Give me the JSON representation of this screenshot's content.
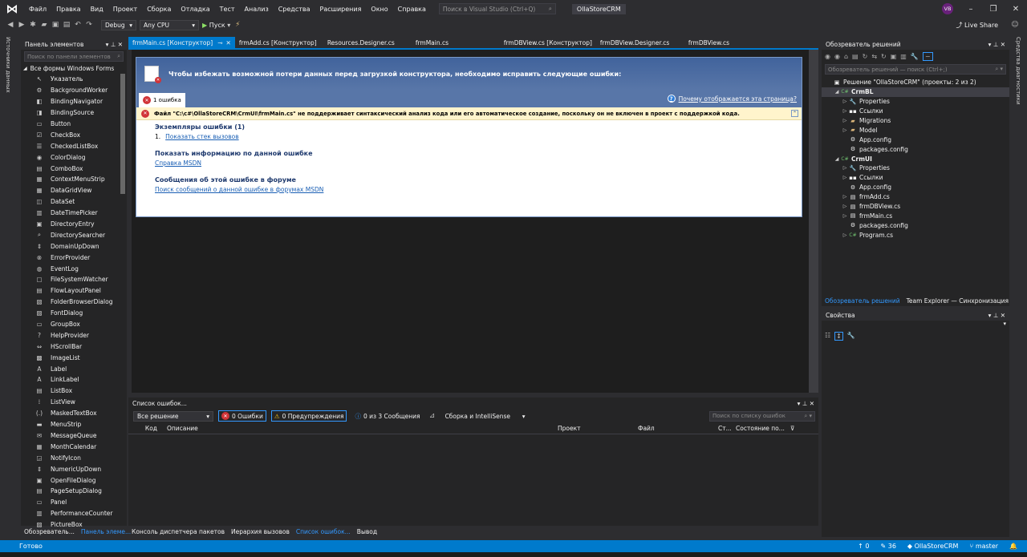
{
  "menu": {
    "items": [
      "Файл",
      "Правка",
      "Вид",
      "Проект",
      "Сборка",
      "Отладка",
      "Тест",
      "Анализ",
      "Средства",
      "Расширения",
      "Окно",
      "Справка"
    ],
    "search_placeholder": "Поиск в Visual Studio (Ctrl+Q)",
    "project_name": "OllaStoreCRM",
    "user_initials": "VB"
  },
  "toolbar": {
    "config": "Debug",
    "platform": "Any CPU",
    "run_label": "Пуск",
    "live_share": "Live Share"
  },
  "side_strip": {
    "label": "Источники данных"
  },
  "right_strip": {
    "label": "Средства диагностики"
  },
  "toolbox": {
    "title": "Панель элементов",
    "search_placeholder": "Поиск по панели элементов",
    "group": "Все формы Windows Forms",
    "items": [
      {
        "label": "Указатель",
        "icon": "pointer-icon",
        "glyph": "↖"
      },
      {
        "label": "BackgroundWorker",
        "icon": "backgroundworker-icon",
        "glyph": "⚙"
      },
      {
        "label": "BindingNavigator",
        "icon": "bindingnavigator-icon",
        "glyph": "◧"
      },
      {
        "label": "BindingSource",
        "icon": "bindingsource-icon",
        "glyph": "◨"
      },
      {
        "label": "Button",
        "icon": "button-icon",
        "glyph": "▭"
      },
      {
        "label": "CheckBox",
        "icon": "checkbox-icon",
        "glyph": "☑"
      },
      {
        "label": "CheckedListBox",
        "icon": "checkedlistbox-icon",
        "glyph": "☰"
      },
      {
        "label": "ColorDialog",
        "icon": "colordialog-icon",
        "glyph": "◉"
      },
      {
        "label": "ComboBox",
        "icon": "combobox-icon",
        "glyph": "▤"
      },
      {
        "label": "ContextMenuStrip",
        "icon": "contextmenustrip-icon",
        "glyph": "▦"
      },
      {
        "label": "DataGridView",
        "icon": "datagridview-icon",
        "glyph": "▦"
      },
      {
        "label": "DataSet",
        "icon": "dataset-icon",
        "glyph": "◫"
      },
      {
        "label": "DateTimePicker",
        "icon": "datetimepicker-icon",
        "glyph": "▥"
      },
      {
        "label": "DirectoryEntry",
        "icon": "directoryentry-icon",
        "glyph": "▣"
      },
      {
        "label": "DirectorySearcher",
        "icon": "directorysearcher-icon",
        "glyph": "⌕"
      },
      {
        "label": "DomainUpDown",
        "icon": "domainupdown-icon",
        "glyph": "⇕"
      },
      {
        "label": "ErrorProvider",
        "icon": "errorprovider-icon",
        "glyph": "⊗"
      },
      {
        "label": "EventLog",
        "icon": "eventlog-icon",
        "glyph": "◍"
      },
      {
        "label": "FileSystemWatcher",
        "icon": "filesystemwatcher-icon",
        "glyph": "▢"
      },
      {
        "label": "FlowLayoutPanel",
        "icon": "flowlayoutpanel-icon",
        "glyph": "▤"
      },
      {
        "label": "FolderBrowserDialog",
        "icon": "folderbrowserdialog-icon",
        "glyph": "▧"
      },
      {
        "label": "FontDialog",
        "icon": "fontdialog-icon",
        "glyph": "▨"
      },
      {
        "label": "GroupBox",
        "icon": "groupbox-icon",
        "glyph": "▭"
      },
      {
        "label": "HelpProvider",
        "icon": "helpprovider-icon",
        "glyph": "?"
      },
      {
        "label": "HScrollBar",
        "icon": "hscrollbar-icon",
        "glyph": "⇔"
      },
      {
        "label": "ImageList",
        "icon": "imagelist-icon",
        "glyph": "▩"
      },
      {
        "label": "Label",
        "icon": "label-icon",
        "glyph": "A"
      },
      {
        "label": "LinkLabel",
        "icon": "linklabel-icon",
        "glyph": "A"
      },
      {
        "label": "ListBox",
        "icon": "listbox-icon",
        "glyph": "▤"
      },
      {
        "label": "ListView",
        "icon": "listview-icon",
        "glyph": "⁞"
      },
      {
        "label": "MaskedTextBox",
        "icon": "maskedtextbox-icon",
        "glyph": "(.)"
      },
      {
        "label": "MenuStrip",
        "icon": "menustrip-icon",
        "glyph": "▬"
      },
      {
        "label": "MessageQueue",
        "icon": "messagequeue-icon",
        "glyph": "✉"
      },
      {
        "label": "MonthCalendar",
        "icon": "monthcalendar-icon",
        "glyph": "▦"
      },
      {
        "label": "NotifyIcon",
        "icon": "notifyicon-icon",
        "glyph": "◲"
      },
      {
        "label": "NumericUpDown",
        "icon": "numericupdown-icon",
        "glyph": "⇕"
      },
      {
        "label": "OpenFileDialog",
        "icon": "openfiledialog-icon",
        "glyph": "▣"
      },
      {
        "label": "PageSetupDialog",
        "icon": "pagesetupdialog-icon",
        "glyph": "▤"
      },
      {
        "label": "Panel",
        "icon": "panel-icon",
        "glyph": "▭"
      },
      {
        "label": "PerformanceCounter",
        "icon": "performancecounter-icon",
        "glyph": "▥"
      },
      {
        "label": "PictureBox",
        "icon": "picturebox-icon",
        "glyph": "▨"
      }
    ]
  },
  "left_tabs": [
    "Обозреватель...",
    "Панель элеме..."
  ],
  "doc_tabs": [
    {
      "label": "frmMain.cs [Конструктор]",
      "active": true
    },
    {
      "label": "frmAdd.cs [Конструктор]",
      "active": false
    },
    {
      "label": "Resources.Designer.cs",
      "active": false
    },
    {
      "label": "frmMain.cs",
      "active": false
    },
    {
      "label": "frmDBView.cs [Конструктор]",
      "active": false
    },
    {
      "label": "frmDBView.Designer.cs",
      "active": false
    },
    {
      "label": "frmDBView.cs",
      "active": false
    }
  ],
  "designer_error": {
    "header": "Чтобы избежать возможной потери данных перед загрузкой конструктора, необходимо исправить следующие ошибки:",
    "tab": "1 ошибка",
    "why_link": "Почему отображается эта страница?",
    "error_text": "Файл \"C:\\c#\\OllaStoreCRM\\CrmUI\\frmMain.cs\" не поддерживает синтаксический анализ кода или его автоматическое создание, поскольку он не включен в проект с поддержкой кода.",
    "instances_title": "Экземпляры ошибки (1)",
    "instance_num": "1.",
    "instance_link": "Показать стек вызовов",
    "help_title": "Показать информацию по данной ошибке",
    "help_link": "Справка MSDN",
    "forum_title": "Сообщения об этой ошибке в форуме",
    "forum_link": "Поиск сообщений о данной ошибке в форумах MSDN"
  },
  "error_list": {
    "title": "Список ошибок...",
    "scope": "Все решение",
    "errors": "0 Ошибки",
    "warnings": "0 Предупреждения",
    "messages": "0 из 3 Сообщения",
    "build": "Сборка и IntelliSense",
    "search_placeholder": "Поиск по списку ошибок",
    "columns": [
      "Код",
      "Описание",
      "Проект",
      "Файл",
      "Ст...",
      "Состояние по..."
    ]
  },
  "bottom_tabs": [
    "Консоль диспетчера пакетов",
    "Иерархия вызовов",
    "Список ошибок...",
    "Вывод"
  ],
  "solution_explorer": {
    "title": "Обозреватель решений",
    "search_placeholder": "Обозреватель решений — поиск (Ctrl+;)",
    "tree": [
      {
        "label": "Решение \"OllaStoreCRM\" (проекты: 2 из 2)",
        "depth": 0,
        "arrow": "",
        "icon": "solution-icon",
        "glyph": "▣"
      },
      {
        "label": "CrmBL",
        "depth": 1,
        "arrow": "◢",
        "icon": "csharp-project-icon",
        "glyph": "C#",
        "bold": true
      },
      {
        "label": "Properties",
        "depth": 2,
        "arrow": "▷",
        "icon": "wrench-icon",
        "glyph": "🔧"
      },
      {
        "label": "Ссылки",
        "depth": 2,
        "arrow": "▷",
        "icon": "references-icon",
        "glyph": "▪▪"
      },
      {
        "label": "Migrations",
        "depth": 2,
        "arrow": "▷",
        "icon": "folder-icon",
        "glyph": "▰"
      },
      {
        "label": "Model",
        "depth": 2,
        "arrow": "▷",
        "icon": "folder-icon",
        "glyph": "▰"
      },
      {
        "label": "App.config",
        "depth": 2,
        "arrow": "",
        "icon": "config-file-icon",
        "glyph": "⚙"
      },
      {
        "label": "packages.config",
        "depth": 2,
        "arrow": "",
        "icon": "config-file-icon",
        "glyph": "⚙"
      },
      {
        "label": "CrmUI",
        "depth": 1,
        "arrow": "◢",
        "icon": "csharp-project-icon",
        "glyph": "C#",
        "bold": true
      },
      {
        "label": "Properties",
        "depth": 2,
        "arrow": "▷",
        "icon": "wrench-icon",
        "glyph": "🔧"
      },
      {
        "label": "Ссылки",
        "depth": 2,
        "arrow": "▷",
        "icon": "references-icon",
        "glyph": "▪▪"
      },
      {
        "label": "App.config",
        "depth": 2,
        "arrow": "",
        "icon": "config-file-icon",
        "glyph": "⚙"
      },
      {
        "label": "frmAdd.cs",
        "depth": 2,
        "arrow": "▷",
        "icon": "form-file-icon",
        "glyph": "▤"
      },
      {
        "label": "frmDBView.cs",
        "depth": 2,
        "arrow": "▷",
        "icon": "form-file-icon",
        "glyph": "▤"
      },
      {
        "label": "frmMain.cs",
        "depth": 2,
        "arrow": "▷",
        "icon": "form-file-icon",
        "glyph": "▤"
      },
      {
        "label": "packages.config",
        "depth": 2,
        "arrow": "",
        "icon": "config-file-icon",
        "glyph": "⚙"
      },
      {
        "label": "Program.cs",
        "depth": 2,
        "arrow": "▷",
        "icon": "csharp-file-icon",
        "glyph": "C#"
      }
    ],
    "tabs": [
      "Обозреватель решений",
      "Team Explorer — Синхронизация"
    ]
  },
  "properties": {
    "title": "Свойства"
  },
  "status": {
    "ready": "Готово",
    "up": "0",
    "edits": "36",
    "repo": "OllaStoreCRM",
    "branch": "master"
  },
  "colors": {
    "accent": "#007acc",
    "bg": "#2d2d30",
    "panel": "#252526",
    "editor": "#1e1e1e"
  }
}
